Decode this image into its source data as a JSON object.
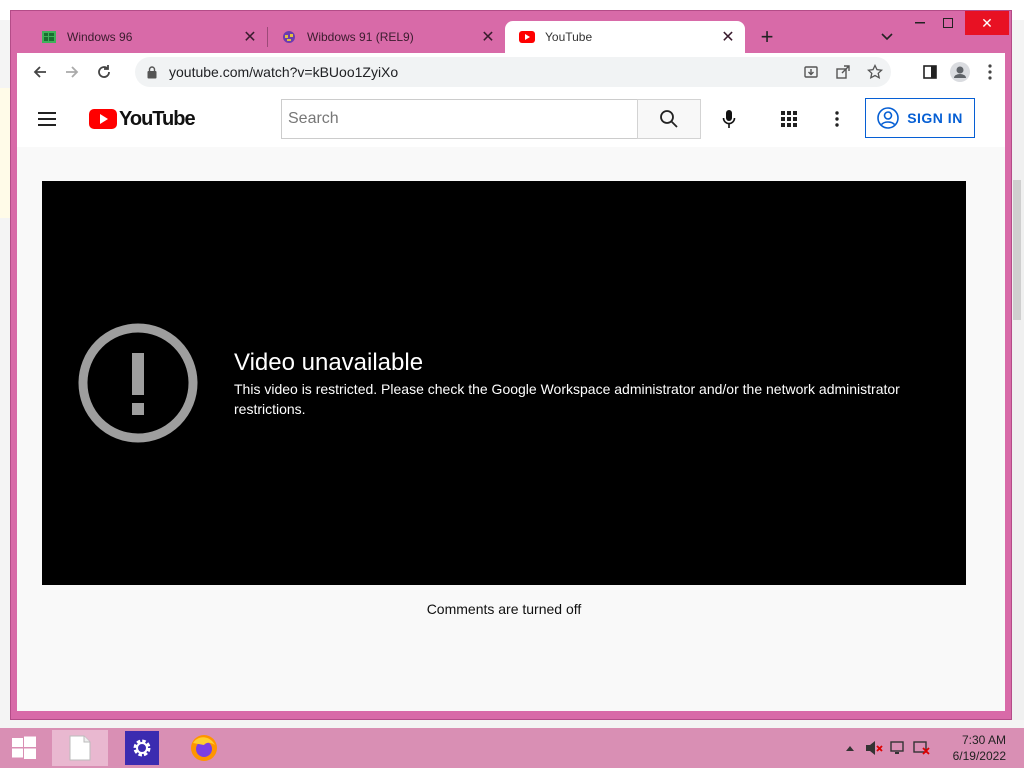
{
  "browser": {
    "tabs": [
      {
        "title": "Windows 96",
        "icon": "windows96-icon"
      },
      {
        "title": "Wibdows 91 (REL9)",
        "icon": "wibdows91-icon"
      },
      {
        "title": "YouTube",
        "icon": "youtube-icon"
      }
    ],
    "active_tab": 2,
    "url": "youtube.com/watch?v=kBUoo1ZyiXo",
    "colors": {
      "frame": "#d86aa8",
      "active_tab": "#ffffff"
    }
  },
  "youtube": {
    "search_placeholder": "Search",
    "sign_in_label": "SIGN IN",
    "logo_text": "YouTube",
    "error_title": "Video unavailable",
    "error_message": "This video is restricted. Please check the Google Workspace administrator and/or the network administrator restrictions.",
    "comments_text": "Comments are turned off",
    "colors": {
      "accent": "#065fd4",
      "logo_red": "#ff0000"
    }
  },
  "taskbar": {
    "time": "7:30 AM",
    "date": "6/19/2022",
    "apps": [
      "file-explorer",
      "settings",
      "firefox"
    ]
  }
}
